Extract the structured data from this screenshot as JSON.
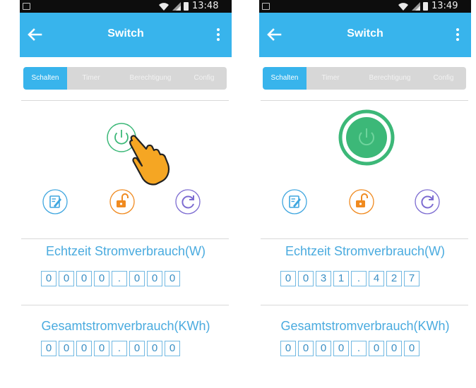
{
  "screens": [
    {
      "status_time": "13:48",
      "title": "Switch",
      "tabs": [
        "Schalten",
        "Timer",
        "Berechtigung",
        "Config"
      ],
      "power_state": "off",
      "realtime_label": "Echtzeit Stromverbrauch(W)",
      "realtime_digits": [
        "0",
        "0",
        "0",
        "0",
        ".",
        "0",
        "0",
        "0"
      ],
      "total_label": "Gesamtstromverbrauch(KWh)",
      "total_digits": [
        "0",
        "0",
        "0",
        "0",
        ".",
        "0",
        "0",
        "0"
      ]
    },
    {
      "status_time": "13:49",
      "title": "Switch",
      "tabs": [
        "Schalten",
        "Timer",
        "Berechtigung",
        "Config"
      ],
      "power_state": "on",
      "realtime_label": "Echtzeit Stromverbrauch(W)",
      "realtime_digits": [
        "0",
        "0",
        "3",
        "1",
        ".",
        "4",
        "2",
        "7"
      ],
      "total_label": "Gesamtstromverbrauch(KWh)",
      "total_digits": [
        "0",
        "0",
        "0",
        "0",
        ".",
        "0",
        "0",
        "0"
      ]
    }
  ],
  "colors": {
    "accent": "#38b4ec",
    "power_green": "#3cb878",
    "edit_blue": "#3fa6df",
    "lock_orange": "#f08a1f",
    "refresh_purple": "#7c6bd1",
    "digit_border": "#72b9e2",
    "label_blue": "#4aabdf"
  },
  "icons": {
    "back": "arrow-left-icon",
    "menu": "more-vert-icon",
    "power": "power-icon",
    "edit": "edit-icon",
    "lock": "unlock-icon",
    "refresh": "refresh-icon",
    "hand": "tap-hand-icon"
  }
}
